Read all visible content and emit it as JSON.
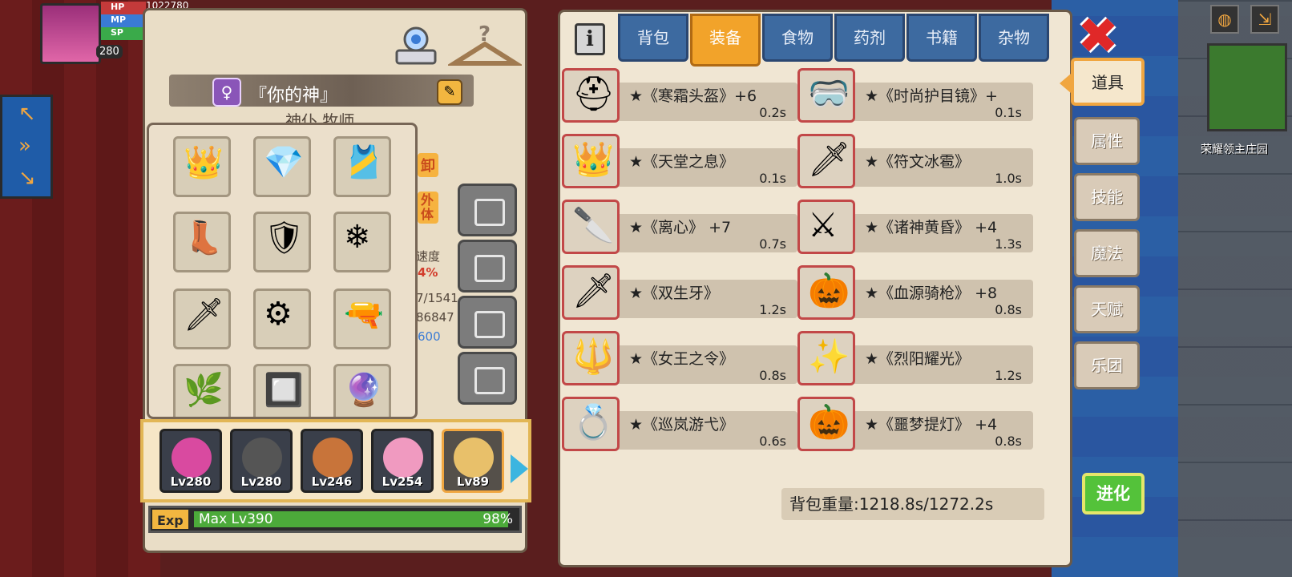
{
  "hud": {
    "hp_label": "HP",
    "mp_label": "MP",
    "sp_label": "SP",
    "hp_value": "1022780",
    "player_level": "280"
  },
  "character": {
    "gender_symbol": "♀",
    "name": "『你的神』",
    "class_name": "神仆 牧师",
    "side_labels": [
      "卸",
      "外体"
    ],
    "stat_label": "速度",
    "stat_value": "4%",
    "stat_line_1": "7/1541",
    "stat_line_2": "86847",
    "stat_line_3": "600"
  },
  "equipment_slots": [
    {
      "icon": "crown-icon",
      "glyph": "👑"
    },
    {
      "icon": "amulet-icon",
      "glyph": "💎"
    },
    {
      "icon": "belt-icon",
      "glyph": "🎽"
    },
    {
      "icon": "boots-icon",
      "glyph": "👢"
    },
    {
      "icon": "armor-icon",
      "glyph": "🛡"
    },
    {
      "icon": "snowflake-rune-icon",
      "glyph": "❄"
    },
    {
      "icon": "blade-icon",
      "glyph": "🗡"
    },
    {
      "icon": "gear-orb-icon",
      "glyph": "⚙"
    },
    {
      "icon": "gun-icon",
      "glyph": "🔫"
    },
    {
      "icon": "branch-icon",
      "glyph": "🌿"
    },
    {
      "icon": "chip-icon",
      "glyph": "🔲"
    },
    {
      "icon": "orb-staff-icon",
      "glyph": "🔮"
    }
  ],
  "party": [
    {
      "level": "Lv280",
      "color": "#d94aa0"
    },
    {
      "level": "Lv280",
      "color": "#2b2b2b"
    },
    {
      "level": "Lv246",
      "color": "#c8743a"
    },
    {
      "level": "Lv254",
      "color": "#f09ac0"
    },
    {
      "level": "Lv89",
      "color": "#e8c06a"
    }
  ],
  "exp": {
    "tag": "Exp",
    "text": "Max Lv390",
    "percent_label": "98%",
    "fill_fraction": 0.98
  },
  "inventory": {
    "info_label": "i",
    "tabs": [
      "背包",
      "装备",
      "食物",
      "药剂",
      "书籍",
      "杂物"
    ],
    "active_tab": "装备",
    "items": [
      {
        "name": "★《寒霜头盔》+6",
        "weight": "0.2s",
        "glyph": "⛑",
        "icon": "frost-helmet-icon"
      },
      {
        "name": "★《时尚护目镜》+",
        "weight": "0.1s",
        "glyph": "🥽",
        "icon": "goggles-icon"
      },
      {
        "name": "★《天堂之息》",
        "weight": "0.1s",
        "glyph": "👑",
        "icon": "halo-crown-icon"
      },
      {
        "name": "★《符文冰雹》",
        "weight": "1.0s",
        "glyph": "🗡",
        "icon": "ice-sword-icon"
      },
      {
        "name": "★《离心》 +7",
        "weight": "0.7s",
        "glyph": "🔪",
        "icon": "dagger-icon"
      },
      {
        "name": "★《诸神黄昏》 +4",
        "weight": "1.3s",
        "glyph": "⚔",
        "icon": "purple-sword-icon"
      },
      {
        "name": "★《双生牙》",
        "weight": "1.2s",
        "glyph": "🗡",
        "icon": "twin-fang-icon"
      },
      {
        "name": "★《血源骑枪》 +8",
        "weight": "0.8s",
        "glyph": "🎃",
        "icon": "lance-icon"
      },
      {
        "name": "★《女王之令》",
        "weight": "0.8s",
        "glyph": "🔱",
        "icon": "scepter-icon"
      },
      {
        "name": "★《烈阳耀光》",
        "weight": "1.2s",
        "glyph": "✨",
        "icon": "sun-spear-icon"
      },
      {
        "name": "★《巡岚游弋》",
        "weight": "0.6s",
        "glyph": "💍",
        "icon": "ring-icon"
      },
      {
        "name": "★《噩梦提灯》 +4",
        "weight": "0.8s",
        "glyph": "🎃",
        "icon": "lantern-icon"
      }
    ],
    "weight_label": "背包重量:1218.8s/1272.2s"
  },
  "menu": {
    "items": [
      "道具",
      "属性",
      "技能",
      "魔法",
      "天赋",
      "乐团"
    ],
    "active": "道具",
    "evolve_label": "进化",
    "close_label": "✖"
  },
  "map": {
    "label": "荣耀领主庄园"
  },
  "colors": {
    "accent": "#f0a640",
    "tab_blue": "#3d6aa0",
    "exp_green": "#4caa3a",
    "close_red": "#e02828"
  }
}
